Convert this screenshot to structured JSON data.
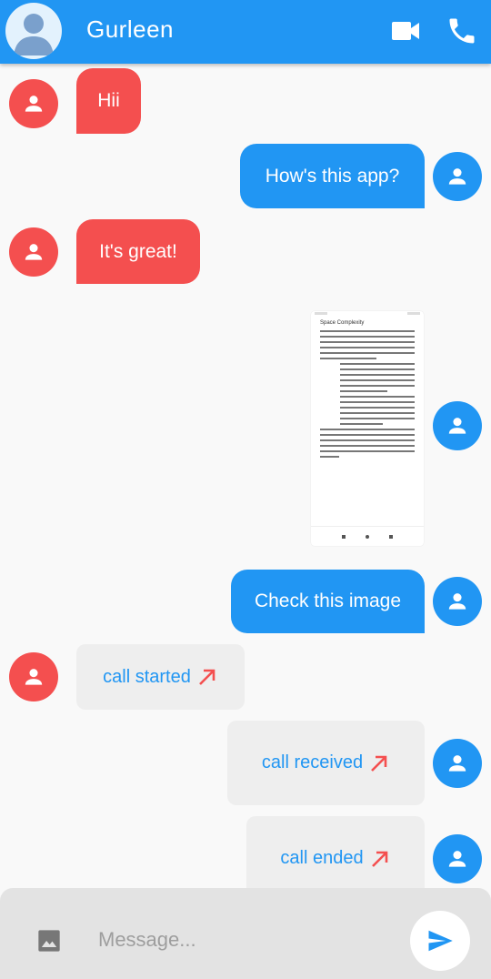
{
  "header": {
    "contact_name": "Gurleen",
    "icons": [
      "person-placeholder-icon",
      "video-call-icon",
      "phone-icon"
    ]
  },
  "colors": {
    "app_bar": "#2196f3",
    "incoming_bubble": "#f44f4f",
    "outgoing_bubble": "#2196f3",
    "call_bubble": "#eeeeee",
    "call_arrow": "#f44f4f"
  },
  "messages": [
    {
      "direction": "incoming",
      "type": "text",
      "text": "Hii"
    },
    {
      "direction": "outgoing",
      "type": "text",
      "text": "How's this app?"
    },
    {
      "direction": "incoming",
      "type": "text",
      "text": "It's great!"
    },
    {
      "direction": "outgoing",
      "type": "image",
      "text": "Space Complexity"
    },
    {
      "direction": "outgoing",
      "type": "text",
      "text": "Check this image"
    },
    {
      "direction": "incoming",
      "type": "call",
      "text": "call started"
    },
    {
      "direction": "outgoing",
      "type": "call",
      "text": "call received"
    },
    {
      "direction": "outgoing",
      "type": "call",
      "text": "call ended"
    }
  ],
  "composer": {
    "placeholder": "Message...",
    "icons": [
      "image-icon",
      "send-icon"
    ]
  }
}
